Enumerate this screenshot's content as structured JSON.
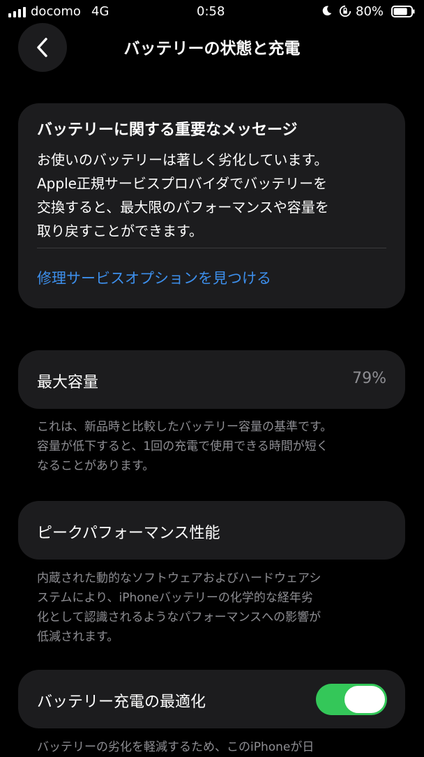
{
  "status_bar": {
    "carrier": "docomo",
    "network": "4G",
    "time": "0:58",
    "battery_percent": "80%",
    "battery_level": 0.8,
    "icons": [
      "signal-icon",
      "moon-icon",
      "orientation-lock-icon",
      "battery-icon"
    ]
  },
  "nav": {
    "back_icon": "chevron-left-icon",
    "title": "バッテリーの状態と充電"
  },
  "message_card": {
    "title": "バッテリーに関する重要なメッセージ",
    "body_lines": [
      "お使いのバッテリーは著しく劣化しています。",
      "Apple正規サービスプロバイダでバッテリーを",
      "交換すると、最大限のパフォーマンスや容量を",
      "取り戻すことができます。"
    ],
    "link": "修理サービスオプションを見つける"
  },
  "max_capacity": {
    "label": "最大容量",
    "value": "79%",
    "footnote_lines": [
      "これは、新品時と比較したバッテリー容量の基準です。",
      "容量が低下すると、1回の充電で使用できる時間が短く",
      "なることがあります。"
    ]
  },
  "peak_performance": {
    "label": "ピークパフォーマンス性能",
    "footnote_lines": [
      "内蔵された動的なソフトウェアおよびハードウェアシ",
      "ステムにより、iPhoneバッテリーの化学的な経年劣",
      "化として認識されるようなパフォーマンスへの影響が",
      "低減されます。"
    ]
  },
  "optimized_charging": {
    "label": "バッテリー充電の最適化",
    "toggle_on": true,
    "footnote_partial": "バッテリーの劣化を軽減するため、このiPhoneが日"
  },
  "colors": {
    "background": "#000000",
    "card": "#1c1c1e",
    "link": "#3d8fec",
    "secondary_text": "#8e8e93",
    "toggle_on": "#34c759"
  }
}
